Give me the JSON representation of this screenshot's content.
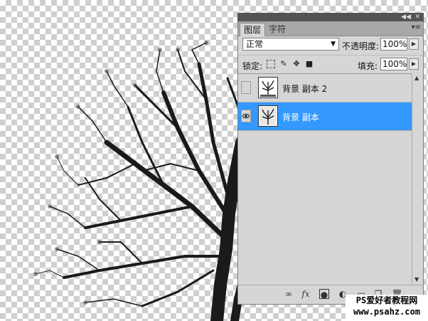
{
  "panel": {
    "tabs": [
      {
        "label": "图层"
      },
      {
        "label": "字符"
      }
    ],
    "blend_mode": "正常",
    "opacity_label": "不透明度:",
    "opacity_value": "100%",
    "lock_label": "锁定:",
    "fill_label": "填充:",
    "fill_value": "100%",
    "layers": [
      {
        "name": "背景 副本 2",
        "visible": false,
        "selected": false
      },
      {
        "name": "背景 副本",
        "visible": true,
        "selected": true
      }
    ],
    "bottom_icons": [
      "link-icon",
      "fx-icon",
      "mask-icon",
      "adjustment-icon",
      "group-icon",
      "new-layer-icon",
      "trash-icon"
    ],
    "selection_color": "#3399ff"
  },
  "watermark": {
    "line1": "PS爱好者教程网",
    "line2": "www.psahz.com"
  }
}
